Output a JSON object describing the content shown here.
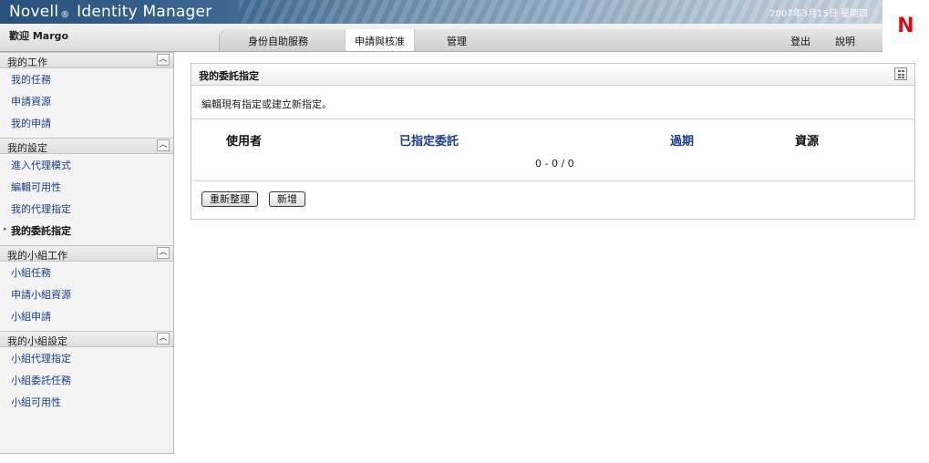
{
  "header": {
    "brand_prefix": "Novell",
    "brand_reg": "®",
    "brand_suffix": "Identity Manager",
    "date": "2007年3月15日 星期四",
    "logo": "N",
    "welcome": "歡迎 Margo"
  },
  "tabs": [
    {
      "label": "身份自助服務"
    },
    {
      "label": "申請與核准",
      "active": true
    },
    {
      "label": "管理"
    }
  ],
  "utility_links": {
    "logout": "登出",
    "help": "說明"
  },
  "sidebar": {
    "sections": [
      {
        "title": "我的工作",
        "items": [
          "我的任務",
          "申請資源",
          "我的申請"
        ]
      },
      {
        "title": "我的設定",
        "items": [
          "進入代理模式",
          "編輯可用性",
          "我的代理指定",
          "我的委託指定"
        ],
        "active_item": "我的委託指定"
      },
      {
        "title": "我的小組工作",
        "items": [
          "小組任務",
          "申請小組資源",
          "小組申請"
        ]
      },
      {
        "title": "我的小組設定",
        "items": [
          "小組代理指定",
          "小組委託任務",
          "小組可用性"
        ]
      }
    ]
  },
  "panel": {
    "title": "我的委託指定",
    "description": "編輯現有指定或建立新指定。",
    "columns": {
      "user": "使用者",
      "assigned_delegate": "已指定委託",
      "expires": "過期",
      "resource": "資源"
    },
    "paging": "0 - 0 / 0",
    "buttons": {
      "refresh": "重新整理",
      "add": "新增"
    }
  },
  "colors": {
    "link": "#1e3c8c",
    "logo_red": "#d01018",
    "banner_dark": "#28507c"
  }
}
